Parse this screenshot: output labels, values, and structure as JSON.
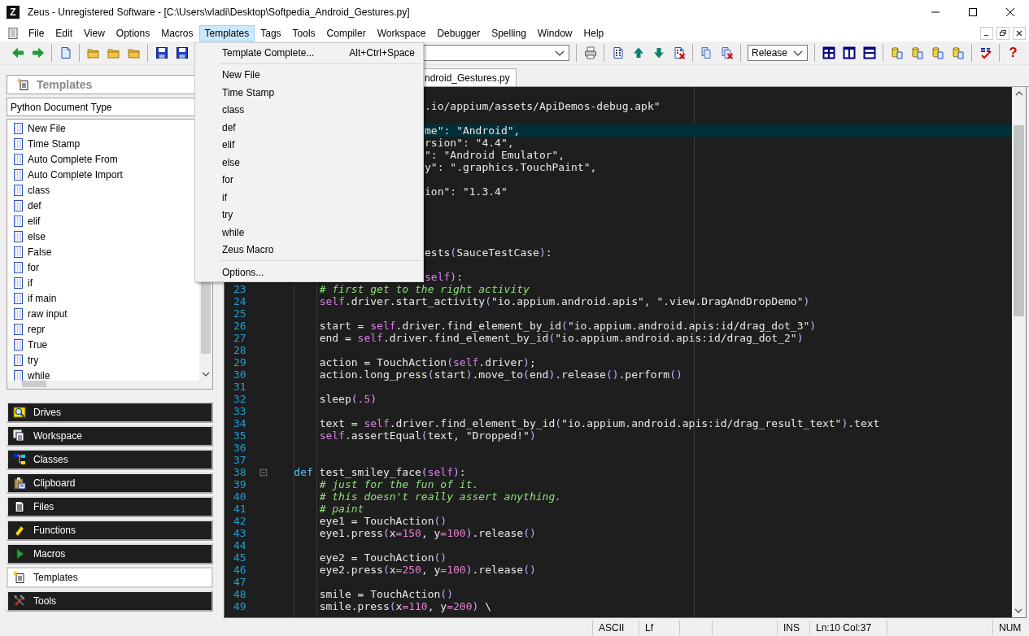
{
  "window": {
    "app_icon_letter": "Z",
    "title": "Zeus - Unregistered Software - [C:\\Users\\vladi\\Desktop\\Softpedia_Android_Gestures.py]"
  },
  "menu_bar": [
    {
      "label": "File",
      "selected": false
    },
    {
      "label": "Edit",
      "selected": false
    },
    {
      "label": "View",
      "selected": false
    },
    {
      "label": "Options",
      "selected": false
    },
    {
      "label": "Macros",
      "selected": false
    },
    {
      "label": "Templates",
      "selected": true
    },
    {
      "label": "Tags",
      "selected": false
    },
    {
      "label": "Tools",
      "selected": false
    },
    {
      "label": "Compiler",
      "selected": false
    },
    {
      "label": "Workspace",
      "selected": false
    },
    {
      "label": "Debugger",
      "selected": false
    },
    {
      "label": "Spelling",
      "selected": false
    },
    {
      "label": "Window",
      "selected": false
    },
    {
      "label": "Help",
      "selected": false
    }
  ],
  "toolbar": {
    "configuration": "Release",
    "help_glyph": "?"
  },
  "templates_menu": [
    {
      "kind": "item",
      "label": "Template Complete...",
      "shortcut": "Alt+Ctrl+Space"
    },
    {
      "kind": "separator"
    },
    {
      "kind": "item",
      "label": "New File"
    },
    {
      "kind": "item",
      "label": "Time Stamp"
    },
    {
      "kind": "item",
      "label": "class"
    },
    {
      "kind": "item",
      "label": "def"
    },
    {
      "kind": "item",
      "label": "elif"
    },
    {
      "kind": "item",
      "label": "else"
    },
    {
      "kind": "item",
      "label": "for"
    },
    {
      "kind": "item",
      "label": "if"
    },
    {
      "kind": "item",
      "label": "try"
    },
    {
      "kind": "item",
      "label": "while"
    },
    {
      "kind": "item",
      "label": "Zeus Macro"
    },
    {
      "kind": "separator"
    },
    {
      "kind": "item",
      "label": "Options..."
    }
  ],
  "sidebar": {
    "title": "Templates",
    "document_type": "Python Document Type",
    "templates": [
      "New File",
      "Time Stamp",
      "Auto Complete From",
      "Auto Complete Import",
      "class",
      "def",
      "elif",
      "else",
      "False",
      "for",
      "if",
      "if main",
      "raw input",
      "repr",
      "True",
      "try",
      "while"
    ],
    "panels": [
      {
        "label": "Drives",
        "selected": false
      },
      {
        "label": "Workspace",
        "selected": false
      },
      {
        "label": "Classes",
        "selected": false
      },
      {
        "label": "Clipboard",
        "selected": false
      },
      {
        "label": "Files",
        "selected": false
      },
      {
        "label": "Functions",
        "selected": false
      },
      {
        "label": "Macros",
        "selected": false
      },
      {
        "label": "Templates",
        "selected": true
      },
      {
        "label": "Tools",
        "selected": false
      }
    ]
  },
  "editor": {
    "tab": {
      "label": "ndroid_Gestures.py",
      "selected": true
    },
    "lines": [
      {
        "kind": "clipped",
        "current": false,
        "fold": false,
        "spans": [
          {
            "kind": "plain",
            "text": ".io/appium/assets/ApiDemos-debug.apk\""
          }
        ]
      },
      {
        "kind": "clipped",
        "current": false,
        "fold": false
      },
      {
        "kind": "clipped",
        "current": true,
        "fold": false,
        "spans": [
          {
            "kind": "plain",
            "text": "me\": \"Android\","
          }
        ]
      },
      {
        "kind": "clipped",
        "current": false,
        "fold": false,
        "spans": [
          {
            "kind": "plain",
            "text": "rsion\": \"4.4\","
          }
        ]
      },
      {
        "kind": "clipped",
        "current": false,
        "fold": false,
        "spans": [
          {
            "kind": "plain",
            "text": "\": \"Android Emulator\","
          }
        ]
      },
      {
        "kind": "clipped",
        "current": false,
        "fold": false,
        "spans": [
          {
            "kind": "plain",
            "text": "y\": \".graphics.TouchPaint\","
          }
        ]
      },
      {
        "kind": "clipped",
        "current": false,
        "fold": false
      },
      {
        "kind": "clipped",
        "current": false,
        "fold": false,
        "spans": [
          {
            "kind": "plain",
            "text": "ion\": \"1.3.4\""
          }
        ]
      },
      {
        "kind": "clipped",
        "current": false,
        "fold": false
      },
      {
        "kind": "clipped",
        "current": false,
        "fold": false
      },
      {
        "kind": "clipped",
        "current": false,
        "fold": false
      },
      {
        "kind": "clipped",
        "current": false,
        "fold": false
      },
      {
        "kind": "clipped",
        "current": false,
        "fold": false,
        "spans": [
          {
            "kind": "plain",
            "text": "ests"
          },
          {
            "kind": "punct",
            "text": "("
          },
          {
            "kind": "plain",
            "text": "SauceTestCase"
          },
          {
            "kind": "punct",
            "text": ")"
          },
          {
            "kind": "plain",
            "text": ":"
          }
        ]
      },
      {
        "kind": "clipped",
        "current": false,
        "fold": false
      },
      {
        "kind": "clipped",
        "current": false,
        "fold": false,
        "spans": [
          {
            "kind": "self",
            "text": "self"
          },
          {
            "kind": "punct",
            "text": ")"
          },
          {
            "kind": "plain",
            "text": ":"
          }
        ]
      },
      {
        "kind": "full",
        "number": "23",
        "current": false,
        "fold": false,
        "spans": [
          {
            "kind": "comment",
            "text": "        # first get to the right activity"
          }
        ]
      },
      {
        "kind": "full",
        "number": "24",
        "current": false,
        "fold": false,
        "spans": [
          {
            "kind": "self",
            "text": "        self"
          },
          {
            "kind": "plain",
            "text": ".driver.start_activity"
          },
          {
            "kind": "punct",
            "text": "("
          },
          {
            "kind": "plain",
            "text": "\"io.appium.android.apis\", \".view.DragAndDropDemo\""
          },
          {
            "kind": "punct",
            "text": ")"
          }
        ]
      },
      {
        "kind": "full",
        "number": "25",
        "current": false,
        "fold": false
      },
      {
        "kind": "full",
        "number": "26",
        "current": false,
        "fold": false,
        "spans": [
          {
            "kind": "plain",
            "text": "        start = "
          },
          {
            "kind": "self",
            "text": "self"
          },
          {
            "kind": "plain",
            "text": ".driver.find_element_by_id"
          },
          {
            "kind": "punct",
            "text": "("
          },
          {
            "kind": "plain",
            "text": "\"io.appium.android.apis:id/drag_dot_3\""
          },
          {
            "kind": "punct",
            "text": ")"
          }
        ]
      },
      {
        "kind": "full",
        "number": "27",
        "current": false,
        "fold": false,
        "spans": [
          {
            "kind": "plain",
            "text": "        end = "
          },
          {
            "kind": "self",
            "text": "self"
          },
          {
            "kind": "plain",
            "text": ".driver.find_element_by_id"
          },
          {
            "kind": "punct",
            "text": "("
          },
          {
            "kind": "plain",
            "text": "\"io.appium.android.apis:id/drag_dot_2\""
          },
          {
            "kind": "punct",
            "text": ")"
          }
        ]
      },
      {
        "kind": "full",
        "number": "28",
        "current": false,
        "fold": false
      },
      {
        "kind": "full",
        "number": "29",
        "current": false,
        "fold": false,
        "spans": [
          {
            "kind": "plain",
            "text": "        action = TouchAction"
          },
          {
            "kind": "punct",
            "text": "("
          },
          {
            "kind": "self",
            "text": "self"
          },
          {
            "kind": "plain",
            "text": ".driver"
          },
          {
            "kind": "punct",
            "text": ")"
          },
          {
            "kind": "plain",
            "text": ";"
          }
        ]
      },
      {
        "kind": "full",
        "number": "30",
        "current": false,
        "fold": false,
        "spans": [
          {
            "kind": "plain",
            "text": "        action.long_press"
          },
          {
            "kind": "punct",
            "text": "("
          },
          {
            "kind": "plain",
            "text": "start"
          },
          {
            "kind": "punct",
            "text": ")"
          },
          {
            "kind": "plain",
            "text": ".move_to"
          },
          {
            "kind": "punct",
            "text": "("
          },
          {
            "kind": "plain",
            "text": "end"
          },
          {
            "kind": "punct",
            "text": ")"
          },
          {
            "kind": "plain",
            "text": ".release"
          },
          {
            "kind": "punct",
            "text": "()"
          },
          {
            "kind": "plain",
            "text": ".perform"
          },
          {
            "kind": "punct",
            "text": "()"
          }
        ]
      },
      {
        "kind": "full",
        "number": "31",
        "current": false,
        "fold": false
      },
      {
        "kind": "full",
        "number": "32",
        "current": false,
        "fold": false,
        "spans": [
          {
            "kind": "plain",
            "text": "        sleep"
          },
          {
            "kind": "punct",
            "text": "("
          },
          {
            "kind": "number",
            "text": ".5"
          },
          {
            "kind": "punct",
            "text": ")"
          }
        ]
      },
      {
        "kind": "full",
        "number": "33",
        "current": false,
        "fold": false
      },
      {
        "kind": "full",
        "number": "34",
        "current": false,
        "fold": false,
        "spans": [
          {
            "kind": "plain",
            "text": "        text = "
          },
          {
            "kind": "self",
            "text": "self"
          },
          {
            "kind": "plain",
            "text": ".driver.find_element_by_id"
          },
          {
            "kind": "punct",
            "text": "("
          },
          {
            "kind": "plain",
            "text": "\"io.appium.android.apis:id/drag_result_text\""
          },
          {
            "kind": "punct",
            "text": ")"
          },
          {
            "kind": "plain",
            "text": ".text"
          }
        ]
      },
      {
        "kind": "full",
        "number": "35",
        "current": false,
        "fold": false,
        "spans": [
          {
            "kind": "self",
            "text": "        self"
          },
          {
            "kind": "plain",
            "text": ".assertEqual"
          },
          {
            "kind": "punct",
            "text": "("
          },
          {
            "kind": "plain",
            "text": "text, \"Dropped!\""
          },
          {
            "kind": "punct",
            "text": ")"
          }
        ]
      },
      {
        "kind": "full",
        "number": "36",
        "current": false,
        "fold": false
      },
      {
        "kind": "full",
        "number": "37",
        "current": false,
        "fold": false
      },
      {
        "kind": "full",
        "number": "38",
        "current": false,
        "fold": true,
        "spans": [
          {
            "kind": "keyword",
            "text": "    def"
          },
          {
            "kind": "plain",
            "text": " test_smiley_face"
          },
          {
            "kind": "punct",
            "text": "("
          },
          {
            "kind": "self",
            "text": "self"
          },
          {
            "kind": "punct",
            "text": ")"
          },
          {
            "kind": "plain",
            "text": ":"
          }
        ]
      },
      {
        "kind": "full",
        "number": "39",
        "current": false,
        "fold": false,
        "spans": [
          {
            "kind": "comment",
            "text": "        # just for the fun of it."
          }
        ]
      },
      {
        "kind": "full",
        "number": "40",
        "current": false,
        "fold": false,
        "spans": [
          {
            "kind": "comment",
            "text": "        # this doesn't really assert anything."
          }
        ]
      },
      {
        "kind": "full",
        "number": "41",
        "current": false,
        "fold": false,
        "spans": [
          {
            "kind": "comment",
            "text": "        # paint"
          }
        ]
      },
      {
        "kind": "full",
        "number": "42",
        "current": false,
        "fold": false,
        "spans": [
          {
            "kind": "plain",
            "text": "        eye1 = TouchAction"
          },
          {
            "kind": "punct",
            "text": "()"
          }
        ]
      },
      {
        "kind": "full",
        "number": "43",
        "current": false,
        "fold": false,
        "spans": [
          {
            "kind": "plain",
            "text": "        eye1.press"
          },
          {
            "kind": "punct",
            "text": "("
          },
          {
            "kind": "plain",
            "text": "x"
          },
          {
            "kind": "number",
            "text": "=150"
          },
          {
            "kind": "plain",
            "text": ", y"
          },
          {
            "kind": "number",
            "text": "=100"
          },
          {
            "kind": "punct",
            "text": ")"
          },
          {
            "kind": "plain",
            "text": ".release"
          },
          {
            "kind": "punct",
            "text": "()"
          }
        ]
      },
      {
        "kind": "full",
        "number": "44",
        "current": false,
        "fold": false
      },
      {
        "kind": "full",
        "number": "45",
        "current": false,
        "fold": false,
        "spans": [
          {
            "kind": "plain",
            "text": "        eye2 = TouchAction"
          },
          {
            "kind": "punct",
            "text": "()"
          }
        ]
      },
      {
        "kind": "full",
        "number": "46",
        "current": false,
        "fold": false,
        "spans": [
          {
            "kind": "plain",
            "text": "        eye2.press"
          },
          {
            "kind": "punct",
            "text": "("
          },
          {
            "kind": "plain",
            "text": "x"
          },
          {
            "kind": "number",
            "text": "=250"
          },
          {
            "kind": "plain",
            "text": ", y"
          },
          {
            "kind": "number",
            "text": "=100"
          },
          {
            "kind": "punct",
            "text": ")"
          },
          {
            "kind": "plain",
            "text": ".release"
          },
          {
            "kind": "punct",
            "text": "()"
          }
        ]
      },
      {
        "kind": "full",
        "number": "47",
        "current": false,
        "fold": false
      },
      {
        "kind": "full",
        "number": "48",
        "current": false,
        "fold": false,
        "spans": [
          {
            "kind": "plain",
            "text": "        smile = TouchAction"
          },
          {
            "kind": "punct",
            "text": "()"
          }
        ]
      },
      {
        "kind": "full",
        "number": "49",
        "current": false,
        "fold": false,
        "spans": [
          {
            "kind": "plain",
            "text": "        smile.press"
          },
          {
            "kind": "punct",
            "text": "("
          },
          {
            "kind": "plain",
            "text": "x"
          },
          {
            "kind": "number",
            "text": "=110"
          },
          {
            "kind": "plain",
            "text": ", y"
          },
          {
            "kind": "number",
            "text": "=200"
          },
          {
            "kind": "punct",
            "text": ")"
          },
          {
            "kind": "plain",
            "text": " \\"
          }
        ]
      }
    ]
  },
  "status_bar": [
    "ASCII",
    "Lf",
    "INS",
    "Ln:10 Col:37",
    "NUM"
  ]
}
